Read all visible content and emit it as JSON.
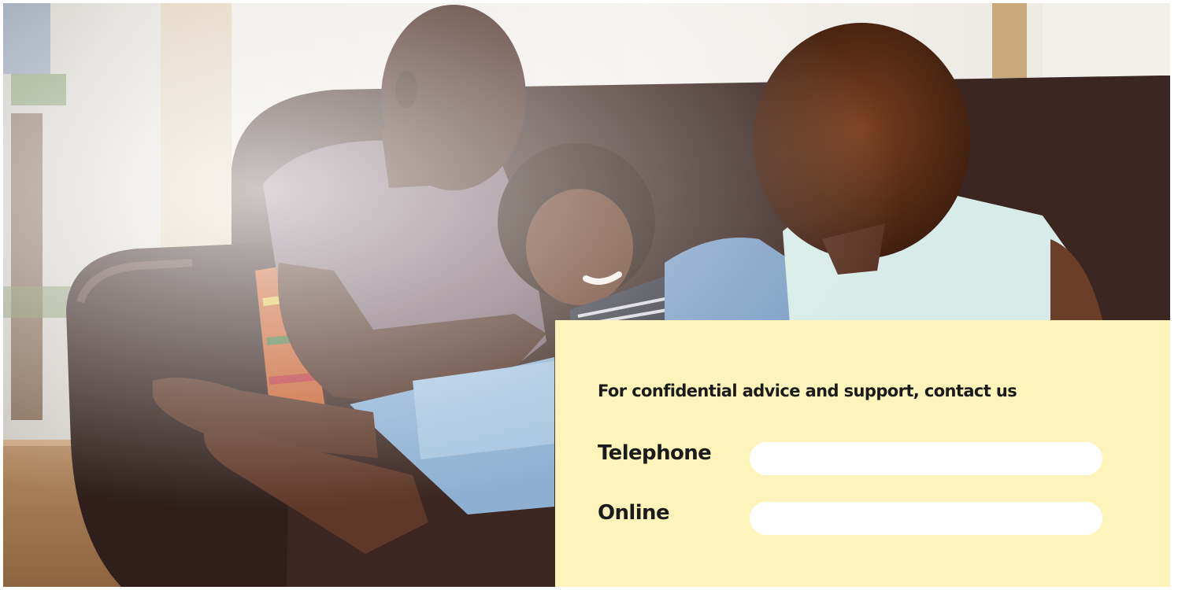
{
  "colors": {
    "panel_background": "#fef4bb",
    "field_background": "#ffffff",
    "text": "#1b1b1b"
  },
  "contact_panel": {
    "heading": "For confidential advice and support, contact us",
    "telephone": {
      "label": "Telephone",
      "value": ""
    },
    "online": {
      "label": "Online",
      "value": ""
    }
  }
}
